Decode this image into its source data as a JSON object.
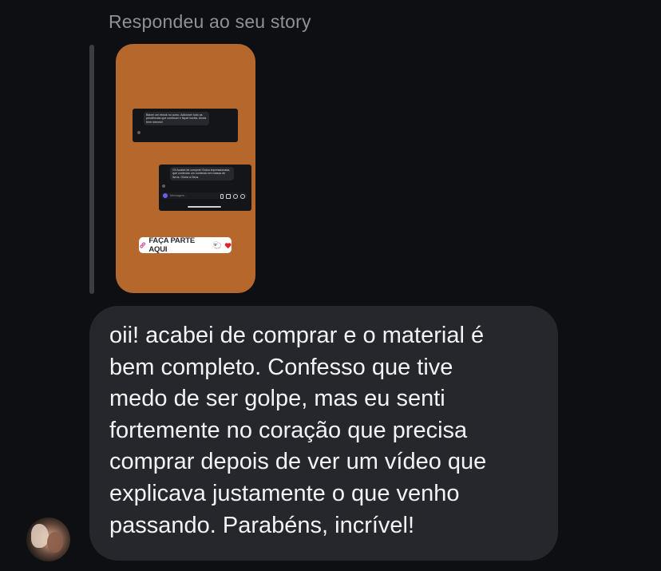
{
  "reply_context": {
    "label": "Respondeu ao seu story"
  },
  "story_preview": {
    "background_color": "#b6672c",
    "card_one_text": "Baixei um ebook no curso. Adicionei tudo as pendências que continuei e fiquei bonita. Ainda bem mesmo!",
    "card_two_text": "Oi! Acabei de comprar! Estou impressionada, que conteúdo um conteúdo em massa de livros. Glória a Deus",
    "input_placeholder": "Mensagem...",
    "cta_label": "FAÇA PARTE AQUI",
    "cta_emoji": "🐑"
  },
  "message": {
    "text": "oii! acabei de comprar e o material é\nbem completo. Confesso que tive\nmedo de ser golpe, mas eu senti\nfortemente no coração que precisa\ncomprar depois de ver um vídeo que\nexplicava justamente o que venho\npassando. Parabéns, incrível!",
    "bubble_color": "#25272c",
    "text_color": "#f2f3f5"
  },
  "sender": {
    "avatar_icon": "profile-photo"
  }
}
